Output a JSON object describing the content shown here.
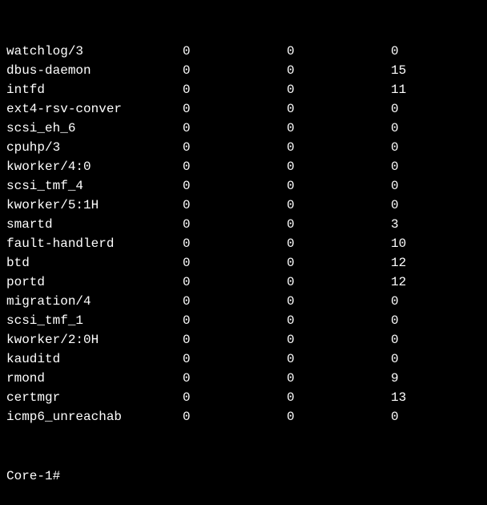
{
  "rows": [
    {
      "name": "watchlog/3",
      "c1": "0",
      "c2": "0",
      "c3": "0"
    },
    {
      "name": "dbus-daemon",
      "c1": "0",
      "c2": "0",
      "c3": "15"
    },
    {
      "name": "intfd",
      "c1": "0",
      "c2": "0",
      "c3": "11"
    },
    {
      "name": "ext4-rsv-conver",
      "c1": "0",
      "c2": "0",
      "c3": "0"
    },
    {
      "name": "scsi_eh_6",
      "c1": "0",
      "c2": "0",
      "c3": "0"
    },
    {
      "name": "cpuhp/3",
      "c1": "0",
      "c2": "0",
      "c3": "0"
    },
    {
      "name": "kworker/4:0",
      "c1": "0",
      "c2": "0",
      "c3": "0"
    },
    {
      "name": "scsi_tmf_4",
      "c1": "0",
      "c2": "0",
      "c3": "0"
    },
    {
      "name": "kworker/5:1H",
      "c1": "0",
      "c2": "0",
      "c3": "0"
    },
    {
      "name": "smartd",
      "c1": "0",
      "c2": "0",
      "c3": "3"
    },
    {
      "name": "fault-handlerd",
      "c1": "0",
      "c2": "0",
      "c3": "10"
    },
    {
      "name": "btd",
      "c1": "0",
      "c2": "0",
      "c3": "12"
    },
    {
      "name": "portd",
      "c1": "0",
      "c2": "0",
      "c3": "12"
    },
    {
      "name": "migration/4",
      "c1": "0",
      "c2": "0",
      "c3": "0"
    },
    {
      "name": "scsi_tmf_1",
      "c1": "0",
      "c2": "0",
      "c3": "0"
    },
    {
      "name": "kworker/2:0H",
      "c1": "0",
      "c2": "0",
      "c3": "0"
    },
    {
      "name": "kauditd",
      "c1": "0",
      "c2": "0",
      "c3": "0"
    },
    {
      "name": "rmond",
      "c1": "0",
      "c2": "0",
      "c3": "9"
    },
    {
      "name": "certmgr",
      "c1": "0",
      "c2": "0",
      "c3": "13"
    },
    {
      "name": "icmp6_unreachab",
      "c1": "0",
      "c2": "0",
      "c3": "0"
    }
  ],
  "prompt": "Core-1#"
}
